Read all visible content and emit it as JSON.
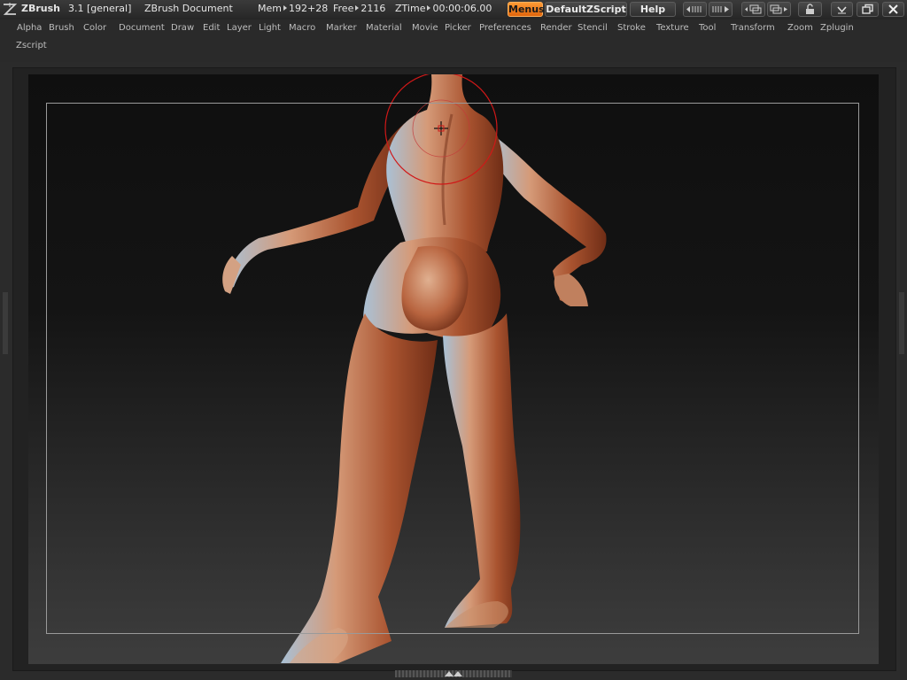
{
  "titlebar": {
    "app": "ZBrush",
    "version": "3.1 [general]",
    "document": "ZBrush Document",
    "mem_label": "Mem",
    "mem_value": "192+28",
    "free_label": "Free",
    "free_value": "2116",
    "ztime_label": "ZTime",
    "ztime_value": "00:00:06.00",
    "menus_button": "Menus",
    "script_button": "DefaultZScript",
    "help_button": "Help"
  },
  "menus": [
    "Alpha",
    "Brush",
    "Color",
    "Document",
    "Draw",
    "Edit",
    "Layer",
    "Light",
    "Macro",
    "Marker",
    "Material",
    "Movie",
    "Picker",
    "Preferences",
    "Render",
    "Stencil",
    "Stroke",
    "Texture",
    "Tool",
    "Transform",
    "Zoom",
    "Zplugin",
    "Zscript"
  ],
  "colors": {
    "accent": "#f07a1a",
    "brush_cursor": "#d01818",
    "skin": "#b8643f"
  },
  "icons": [
    "zbrush-logo-icon",
    "scroll-left-icon",
    "scroll-right-icon",
    "layout-left-icon",
    "layout-right-icon",
    "lock-icon",
    "minimize-icon",
    "restore-icon",
    "close-icon"
  ]
}
